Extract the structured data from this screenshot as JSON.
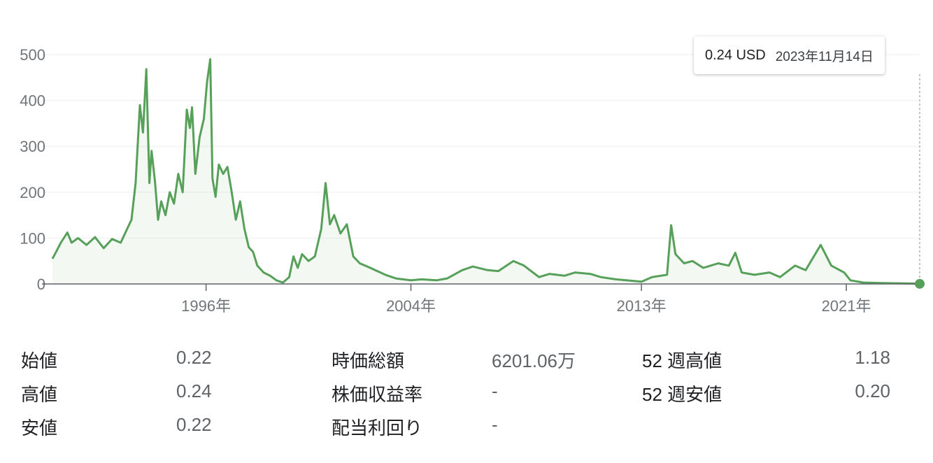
{
  "chart_data": {
    "type": "area",
    "series": [
      {
        "values": [
          [
            "1990-01-01",
            55
          ],
          [
            "1990-03-01",
            72
          ],
          [
            "1990-05-01",
            90
          ],
          [
            "1990-08-01",
            112
          ],
          [
            "1990-10-01",
            90
          ],
          [
            "1991-01-01",
            100
          ],
          [
            "1991-05-01",
            85
          ],
          [
            "1991-09-01",
            102
          ],
          [
            "1992-01-01",
            78
          ],
          [
            "1992-05-01",
            98
          ],
          [
            "1992-09-01",
            90
          ],
          [
            "1992-12-01",
            120
          ],
          [
            "1993-02-01",
            140
          ],
          [
            "1993-04-01",
            220
          ],
          [
            "1993-06-01",
            390
          ],
          [
            "1993-07-15",
            330
          ],
          [
            "1993-09-01",
            468
          ],
          [
            "1993-10-15",
            220
          ],
          [
            "1993-11-15",
            290
          ],
          [
            "1994-01-01",
            225
          ],
          [
            "1994-02-15",
            140
          ],
          [
            "1994-04-01",
            180
          ],
          [
            "1994-06-01",
            150
          ],
          [
            "1994-08-01",
            200
          ],
          [
            "1994-10-01",
            175
          ],
          [
            "1994-12-01",
            240
          ],
          [
            "1995-02-01",
            200
          ],
          [
            "1995-04-01",
            380
          ],
          [
            "1995-05-15",
            340
          ],
          [
            "1995-06-15",
            385
          ],
          [
            "1995-08-01",
            240
          ],
          [
            "1995-10-01",
            320
          ],
          [
            "1995-12-01",
            360
          ],
          [
            "1996-01-15",
            440
          ],
          [
            "1996-03-01",
            490
          ],
          [
            "1996-04-01",
            230
          ],
          [
            "1996-05-15",
            190
          ],
          [
            "1996-07-01",
            260
          ],
          [
            "1996-09-01",
            240
          ],
          [
            "1996-11-01",
            255
          ],
          [
            "1997-01-01",
            200
          ],
          [
            "1997-03-01",
            140
          ],
          [
            "1997-05-01",
            180
          ],
          [
            "1997-07-01",
            120
          ],
          [
            "1997-09-01",
            80
          ],
          [
            "1997-11-01",
            70
          ],
          [
            "1998-01-01",
            40
          ],
          [
            "1998-04-01",
            25
          ],
          [
            "1998-07-01",
            18
          ],
          [
            "1998-10-01",
            8
          ],
          [
            "1999-01-01",
            3
          ],
          [
            "1999-04-01",
            15
          ],
          [
            "1999-06-01",
            60
          ],
          [
            "1999-08-01",
            35
          ],
          [
            "1999-10-01",
            65
          ],
          [
            "2000-01-01",
            50
          ],
          [
            "2000-04-01",
            60
          ],
          [
            "2000-07-01",
            120
          ],
          [
            "2000-09-01",
            220
          ],
          [
            "2000-11-01",
            130
          ],
          [
            "2001-01-01",
            150
          ],
          [
            "2001-04-01",
            110
          ],
          [
            "2001-07-01",
            130
          ],
          [
            "2001-10-01",
            60
          ],
          [
            "2002-01-01",
            45
          ],
          [
            "2002-06-01",
            35
          ],
          [
            "2003-01-01",
            20
          ],
          [
            "2003-06-01",
            12
          ],
          [
            "2004-01-01",
            8
          ],
          [
            "2004-06-01",
            10
          ],
          [
            "2005-01-01",
            8
          ],
          [
            "2005-06-01",
            12
          ],
          [
            "2006-01-01",
            30
          ],
          [
            "2006-06-01",
            38
          ],
          [
            "2007-01-01",
            30
          ],
          [
            "2007-06-01",
            28
          ],
          [
            "2008-01-01",
            50
          ],
          [
            "2008-06-01",
            40
          ],
          [
            "2009-01-01",
            15
          ],
          [
            "2009-06-01",
            22
          ],
          [
            "2010-01-01",
            18
          ],
          [
            "2010-06-01",
            25
          ],
          [
            "2011-01-01",
            22
          ],
          [
            "2011-06-01",
            15
          ],
          [
            "2012-01-01",
            10
          ],
          [
            "2012-06-01",
            8
          ],
          [
            "2013-01-01",
            5
          ],
          [
            "2013-06-01",
            15
          ],
          [
            "2014-01-01",
            20
          ],
          [
            "2014-03-01",
            128
          ],
          [
            "2014-05-01",
            65
          ],
          [
            "2014-09-01",
            45
          ],
          [
            "2015-01-01",
            50
          ],
          [
            "2015-06-01",
            35
          ],
          [
            "2016-01-01",
            45
          ],
          [
            "2016-06-01",
            40
          ],
          [
            "2016-09-01",
            68
          ],
          [
            "2016-12-01",
            25
          ],
          [
            "2017-06-01",
            20
          ],
          [
            "2018-01-01",
            25
          ],
          [
            "2018-06-01",
            15
          ],
          [
            "2019-01-01",
            40
          ],
          [
            "2019-06-01",
            30
          ],
          [
            "2020-01-01",
            85
          ],
          [
            "2020-06-01",
            40
          ],
          [
            "2020-12-01",
            25
          ],
          [
            "2021-03-01",
            8
          ],
          [
            "2021-09-01",
            3
          ],
          [
            "2022-06-01",
            2
          ],
          [
            "2023-06-01",
            1
          ],
          [
            "2023-11-14",
            0.24
          ]
        ]
      }
    ],
    "ylim": [
      0,
      500
    ],
    "yticks": [
      "0",
      "100",
      "200",
      "300",
      "400",
      "500"
    ],
    "xticks": [
      {
        "date": "1996-01-01",
        "label": "1996年"
      },
      {
        "date": "2004-01-01",
        "label": "2004年"
      },
      {
        "date": "2013-01-01",
        "label": "2013年"
      },
      {
        "date": "2021-01-01",
        "label": "2021年"
      }
    ],
    "grid": true,
    "tooltip": {
      "price": "0.24 USD",
      "date": "2023年11月14日"
    },
    "colors": {
      "line": "#57a05a",
      "marker": "#57a05a",
      "grid": "#eeeeee",
      "baseline": "#5f6368"
    }
  },
  "stats": {
    "col1": [
      {
        "label": "始値",
        "value": "0.22"
      },
      {
        "label": "高値",
        "value": "0.24"
      },
      {
        "label": "安値",
        "value": "0.22"
      }
    ],
    "col2": [
      {
        "label": "時価総額",
        "value": "6201.06万"
      },
      {
        "label": "株価収益率",
        "value": "-"
      },
      {
        "label": "配当利回り",
        "value": "-"
      }
    ],
    "col3": [
      {
        "label": "52 週高値",
        "value": "1.18"
      },
      {
        "label": "52 週安値",
        "value": "0.20"
      }
    ]
  }
}
